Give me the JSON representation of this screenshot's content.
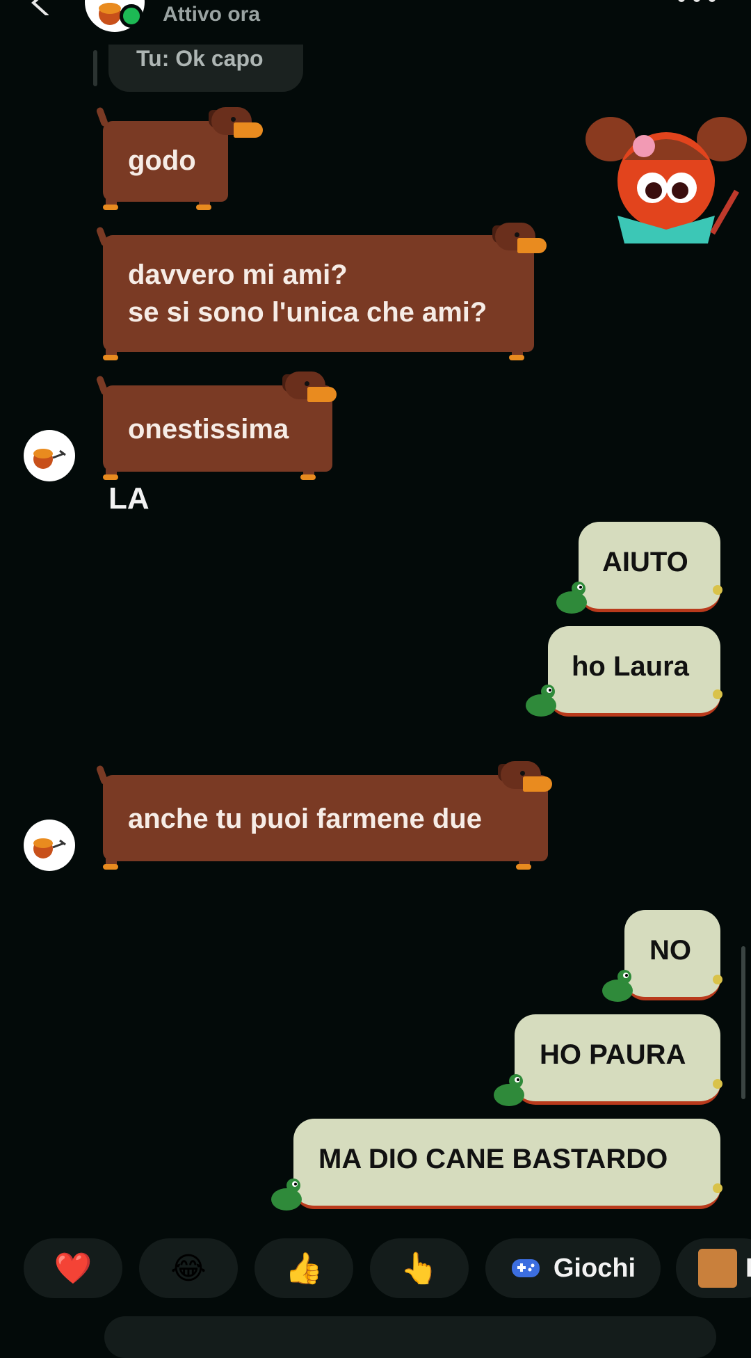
{
  "header": {
    "status": "Attivo ora"
  },
  "reply_preview": {
    "text": "Tu: Ok capo"
  },
  "incoming_messages": [
    {
      "text": "godo"
    },
    {
      "text": "davvero mi ami?\nse si sono l'unica che ami?"
    },
    {
      "text": "onestissima"
    },
    {
      "text": "anche tu puoi farmene due"
    }
  ],
  "la_text": "LA",
  "outgoing_messages": [
    {
      "text": "AIUTO"
    },
    {
      "text": "ho Laura"
    },
    {
      "text": "NO"
    },
    {
      "text": "HO PAURA"
    },
    {
      "text": "MA DIO CANE BASTARDO"
    }
  ],
  "quick_reactions": {
    "heart": "❤️",
    "laugh": "😂",
    "thumbs_up": "👍",
    "point": "👆",
    "games_label": "Giochi",
    "partial_label": "E"
  },
  "colors": {
    "background": "#030a09",
    "incoming_bubble": "#7a3a24",
    "outgoing_bubble": "#d6dcbe",
    "online": "#1db954"
  }
}
